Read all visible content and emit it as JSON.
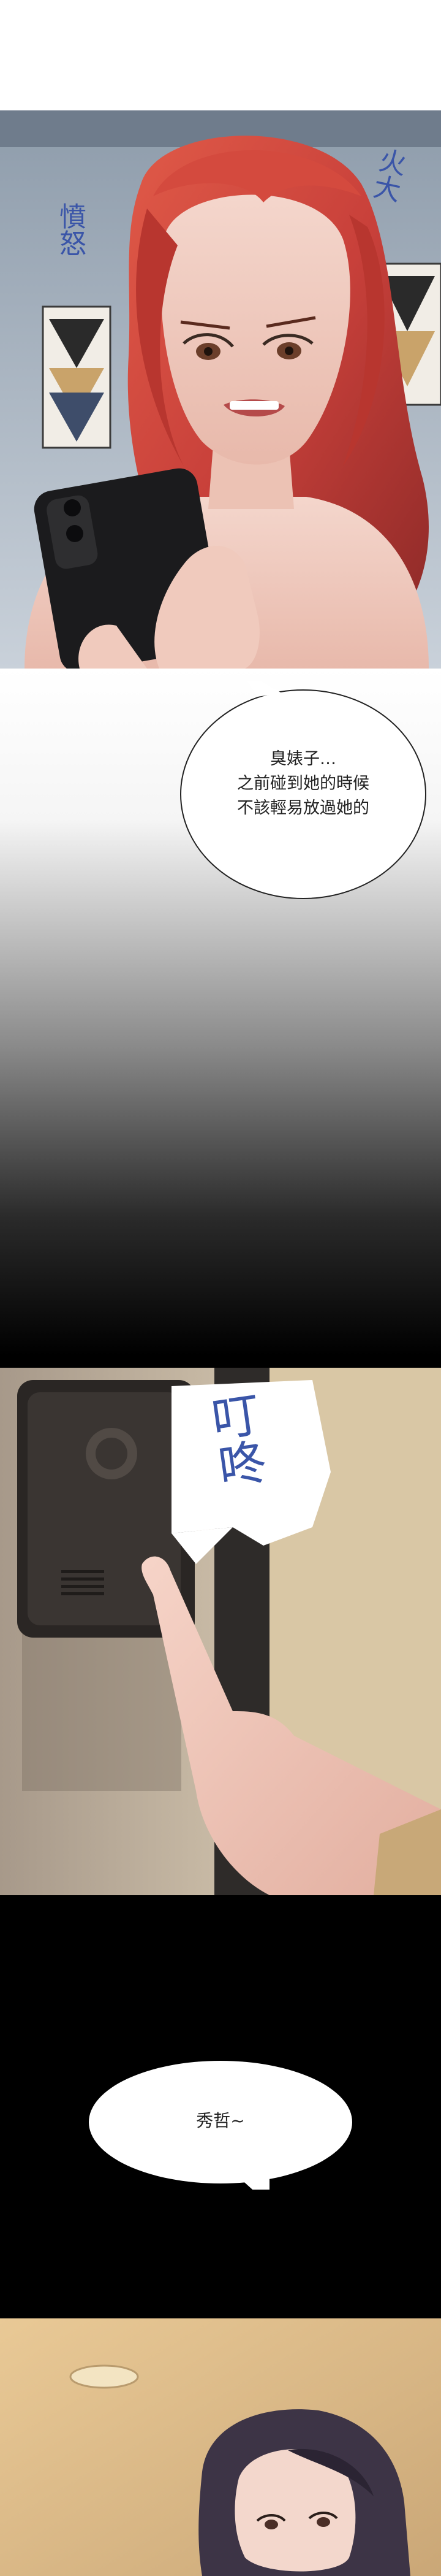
{
  "panel1": {
    "sfx_left": "憤怒",
    "sfx_right": "火大"
  },
  "bubble1": {
    "lines": [
      "臭婊子…",
      "之前碰到她的時候",
      "不該輕易放過她的"
    ]
  },
  "panel2": {
    "sfx": "叮咚"
  },
  "bubble2": {
    "text": "秀哲~"
  },
  "colors": {
    "hair": "#c8403a",
    "wall": "#b9c4cf",
    "night": "#000000",
    "phone": "#1b1b1d",
    "sfx_blue": "#3a55a8",
    "intercom": "#2a2624",
    "door_wall": "#d8c9ad"
  }
}
